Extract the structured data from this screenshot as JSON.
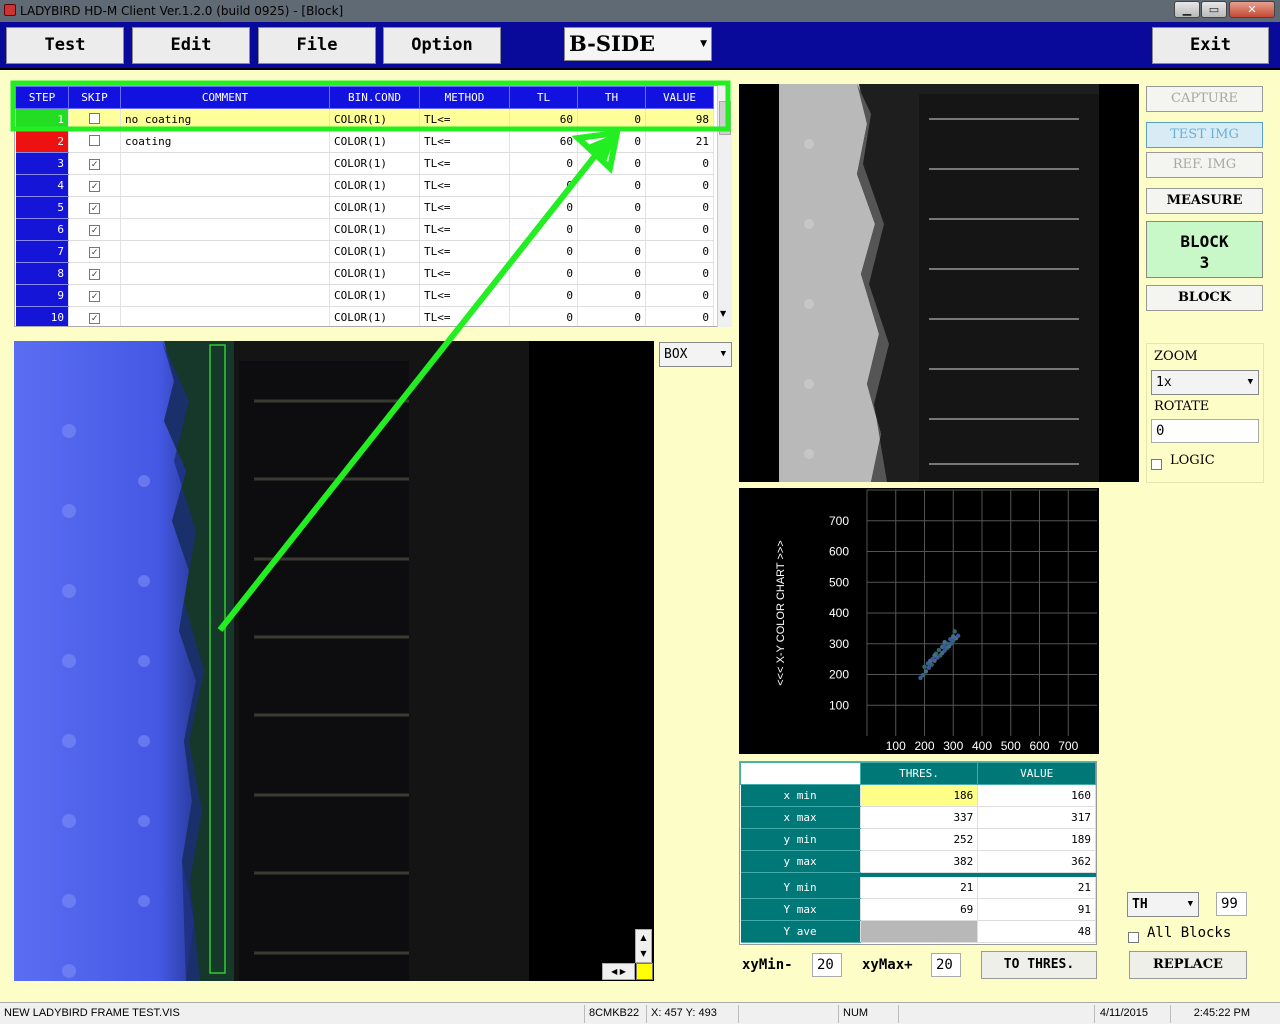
{
  "window": {
    "title": "LADYBIRD HD-M Client Ver.1.2.0  (build 0925) - [Block]",
    "min": "▁",
    "max": "▭",
    "close": "✕"
  },
  "toolbar": {
    "test": "Test",
    "edit": "Edit",
    "file": "File",
    "option": "Option",
    "side": "B-SIDE",
    "exit": "Exit"
  },
  "grid": {
    "headers": [
      "STEP",
      "SKIP",
      "COMMENT",
      "BIN.COND",
      "METHOD",
      "TL",
      "TH",
      "VALUE"
    ],
    "rows": [
      {
        "step": "1",
        "skip": false,
        "comment": "no coating",
        "bin": "COLOR(1)",
        "method": "TL<=",
        "tl": "60",
        "th": "0",
        "value": "98"
      },
      {
        "step": "2",
        "skip": false,
        "comment": "coating",
        "bin": "COLOR(1)",
        "method": "TL<=",
        "tl": "60",
        "th": "0",
        "value": "21"
      },
      {
        "step": "3",
        "skip": true,
        "comment": "",
        "bin": "COLOR(1)",
        "method": "TL<=",
        "tl": "0",
        "th": "0",
        "value": "0"
      },
      {
        "step": "4",
        "skip": true,
        "comment": "",
        "bin": "COLOR(1)",
        "method": "TL<=",
        "tl": "0",
        "th": "0",
        "value": "0"
      },
      {
        "step": "5",
        "skip": true,
        "comment": "",
        "bin": "COLOR(1)",
        "method": "TL<=",
        "tl": "0",
        "th": "0",
        "value": "0"
      },
      {
        "step": "6",
        "skip": true,
        "comment": "",
        "bin": "COLOR(1)",
        "method": "TL<=",
        "tl": "0",
        "th": "0",
        "value": "0"
      },
      {
        "step": "7",
        "skip": true,
        "comment": "",
        "bin": "COLOR(1)",
        "method": "TL<=",
        "tl": "0",
        "th": "0",
        "value": "0"
      },
      {
        "step": "8",
        "skip": true,
        "comment": "",
        "bin": "COLOR(1)",
        "method": "TL<=",
        "tl": "0",
        "th": "0",
        "value": "0"
      },
      {
        "step": "9",
        "skip": true,
        "comment": "",
        "bin": "COLOR(1)",
        "method": "TL<=",
        "tl": "0",
        "th": "0",
        "value": "0"
      },
      {
        "step": "10",
        "skip": true,
        "comment": "",
        "bin": "COLOR(1)",
        "method": "TL<=",
        "tl": "0",
        "th": "0",
        "value": "0"
      }
    ],
    "selected_color": "#ffff99",
    "step_ok_color": "#22dd22",
    "step_ng_color": "#ee1111"
  },
  "shape_select": {
    "value": "BOX"
  },
  "right_buttons": {
    "capture": "CAPTURE",
    "test_img": "TEST IMG",
    "ref_img": "REF. IMG",
    "measure": "MEASURE",
    "block_title": "BLOCK",
    "block_num": "3",
    "block": "BLOCK"
  },
  "zoom": {
    "label": "ZOOM",
    "value": "1x",
    "rotate_label": "ROTATE",
    "rotate_value": "0",
    "logic_label": "LOGIC"
  },
  "chart_data": {
    "type": "scatter",
    "title": "",
    "ylabel": "<<<  X-Y COLOR CHART  >>>",
    "xlabel": "",
    "x_ticks": [
      100,
      200,
      300,
      400,
      500,
      600,
      700
    ],
    "y_ticks": [
      100,
      200,
      300,
      400,
      500,
      600,
      700
    ],
    "xlim": [
      0,
      800
    ],
    "ylim": [
      0,
      800
    ],
    "grid": true,
    "points": [
      [
        186,
        189
      ],
      [
        195,
        198
      ],
      [
        205,
        210
      ],
      [
        215,
        222
      ],
      [
        225,
        232
      ],
      [
        235,
        245
      ],
      [
        245,
        255
      ],
      [
        255,
        262
      ],
      [
        262,
        270
      ],
      [
        270,
        278
      ],
      [
        278,
        286
      ],
      [
        285,
        292
      ],
      [
        292,
        300
      ],
      [
        300,
        310
      ],
      [
        310,
        318
      ],
      [
        317,
        326
      ],
      [
        240,
        268
      ],
      [
        262,
        290
      ],
      [
        228,
        250
      ],
      [
        280,
        300
      ],
      [
        300,
        324
      ],
      [
        212,
        236
      ],
      [
        250,
        280
      ],
      [
        270,
        305
      ],
      [
        290,
        315
      ],
      [
        200,
        225
      ],
      [
        235,
        262
      ],
      [
        268,
        292
      ],
      [
        305,
        340
      ],
      [
        220,
        244
      ]
    ]
  },
  "thres_table": {
    "headers": [
      "",
      "THRES.",
      "VALUE"
    ],
    "rows": [
      {
        "label": "x min",
        "thres": "186",
        "value": "160"
      },
      {
        "label": "x max",
        "thres": "337",
        "value": "317"
      },
      {
        "label": "y min",
        "thres": "252",
        "value": "189"
      },
      {
        "label": "y max",
        "thres": "382",
        "value": "362"
      }
    ],
    "rows2": [
      {
        "label": "Y min",
        "thres": "21",
        "value": "21"
      },
      {
        "label": "Y max",
        "thres": "69",
        "value": "91"
      },
      {
        "label": "Y ave",
        "thres": "",
        "value": "48"
      }
    ]
  },
  "bottom": {
    "xymin_label": "xyMin-",
    "xymin": "20",
    "xymax_label": "xyMax+",
    "xymax": "20",
    "to_thres": "TO THRES.",
    "th_select": "TH",
    "th_value": "99",
    "all_blocks": "All Blocks",
    "replace": "REPLACE"
  },
  "status": {
    "file": "NEW LADYBIRD FRAME TEST.VIS",
    "code": "8CMKB22",
    "coords": "X: 457 Y: 493",
    "num": "NUM",
    "date": "4/11/2015",
    "time": "2:45:22 PM"
  }
}
